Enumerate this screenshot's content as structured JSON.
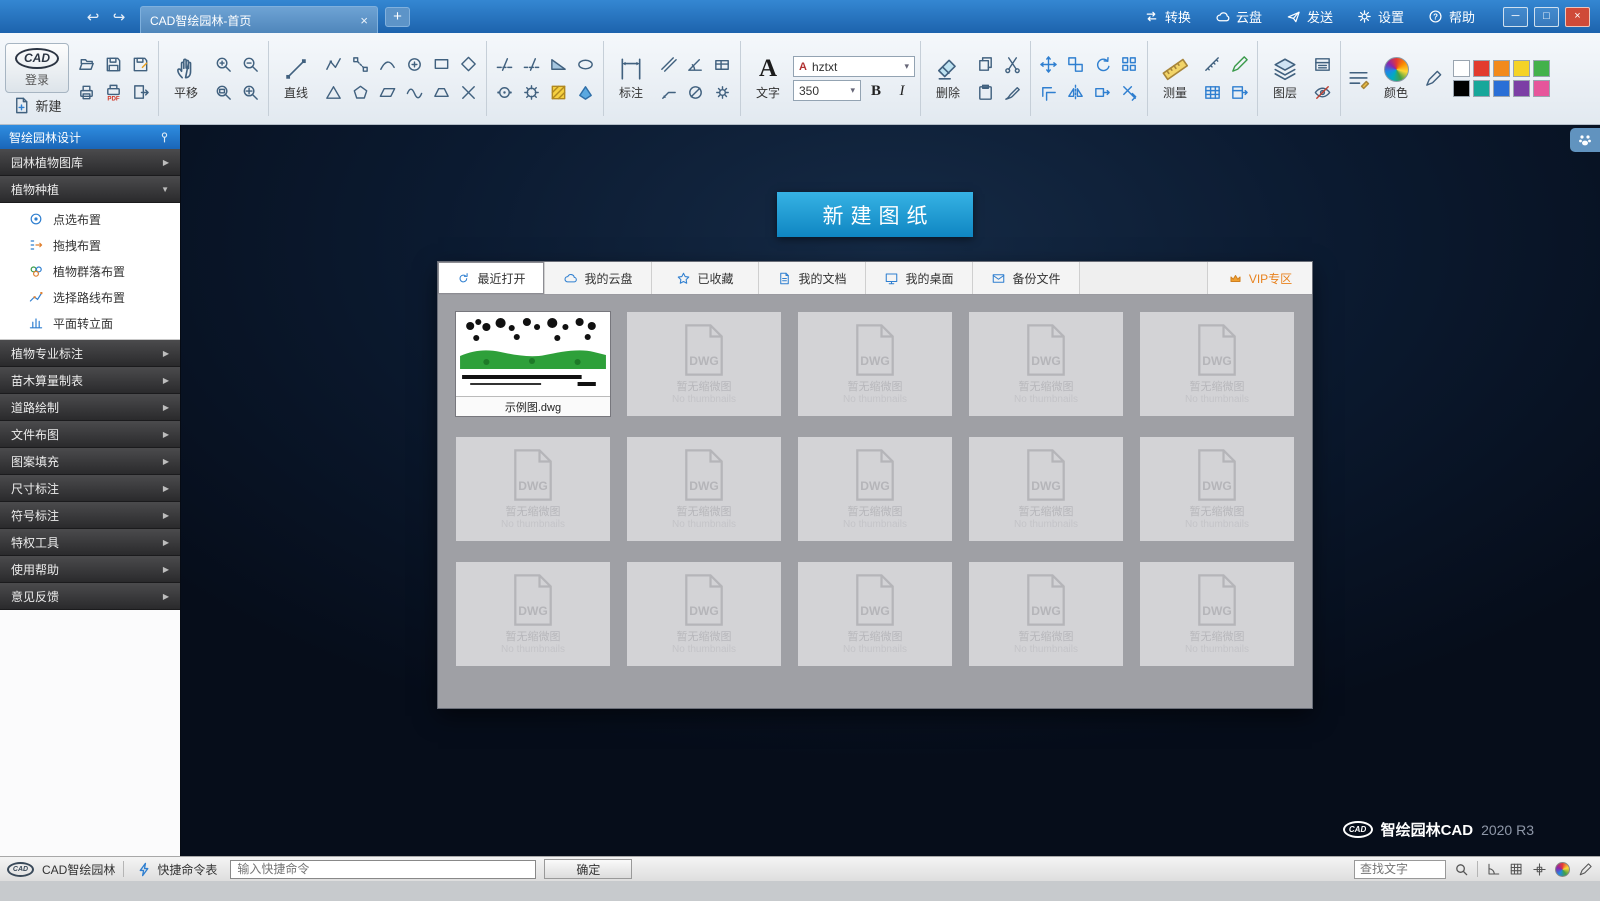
{
  "titlebar": {
    "tab_title": "CAD智绘园林-首页",
    "actions": [
      {
        "label": "转换"
      },
      {
        "label": "云盘"
      },
      {
        "label": "发送"
      },
      {
        "label": "设置"
      },
      {
        "label": "帮助"
      }
    ],
    "glyphs": {
      "back": "↩",
      "forward": "↪",
      "close_tab": "×",
      "new_tab": "+",
      "minimize": "─",
      "maximize": "□",
      "close": "×",
      "help": "?"
    }
  },
  "toolbar": {
    "logo": "CAD",
    "login": "登录",
    "new": "新建",
    "pan": "平移",
    "line": "直线",
    "dim": "标注",
    "text": "文字",
    "text_glyph": "A",
    "font_badge": "A",
    "font": "hztxt",
    "size": "350",
    "caret": "▾",
    "bold": "B",
    "italic": "I",
    "pdf_label": "PDF",
    "delete": "删除",
    "measure": "测量",
    "layer": "图层",
    "color": "颜色",
    "palette_row1": [
      "#ffffff",
      "#e23b2e",
      "#f28a1c",
      "#f5d327",
      "#43b14b"
    ],
    "palette_row2": [
      "#000000",
      "#18a79a",
      "#2a6fd6",
      "#7c3fa5",
      "#e6569b"
    ]
  },
  "sidebar": {
    "header": "智绘园林设计",
    "arrow_right": "▶",
    "arrow_down": "▼",
    "group1": [
      {
        "label": "园林植物图库"
      },
      {
        "label": "植物种植"
      }
    ],
    "plant_tools": [
      {
        "label": "点选布置"
      },
      {
        "label": "拖拽布置"
      },
      {
        "label": "植物群落布置"
      },
      {
        "label": "选择路线布置"
      },
      {
        "label": "平面转立面"
      }
    ],
    "group2": [
      {
        "label": "植物专业标注"
      },
      {
        "label": "苗木算量制表"
      },
      {
        "label": "道路绘制"
      },
      {
        "label": "文件布图"
      },
      {
        "label": "图案填充"
      },
      {
        "label": "尺寸标注"
      },
      {
        "label": "符号标注"
      },
      {
        "label": "特权工具"
      },
      {
        "label": "使用帮助"
      },
      {
        "label": "意见反馈"
      }
    ]
  },
  "main": {
    "new_drawing": "新建图纸",
    "tabs": [
      {
        "label": "最近打开"
      },
      {
        "label": "我的云盘"
      },
      {
        "label": "已收藏"
      },
      {
        "label": "我的文档"
      },
      {
        "label": "我的桌面"
      },
      {
        "label": "备份文件"
      },
      {
        "label": "VIP专区"
      }
    ],
    "sample_file": "示例图.dwg",
    "placeholder": {
      "format": "DWG",
      "no_thumb_cn": "暂无缩微图",
      "no_thumb_en": "No thumbnails"
    },
    "brand_logo": "CAD",
    "brand": "智绘园林CAD",
    "version": "2020 R3"
  },
  "statusbar": {
    "logo": "CAD",
    "app": "CAD智绘园林",
    "quick_cmd": "快捷命令表",
    "cmd_placeholder": "输入快捷命令",
    "ok": "确定",
    "search_placeholder": "查找文字"
  }
}
